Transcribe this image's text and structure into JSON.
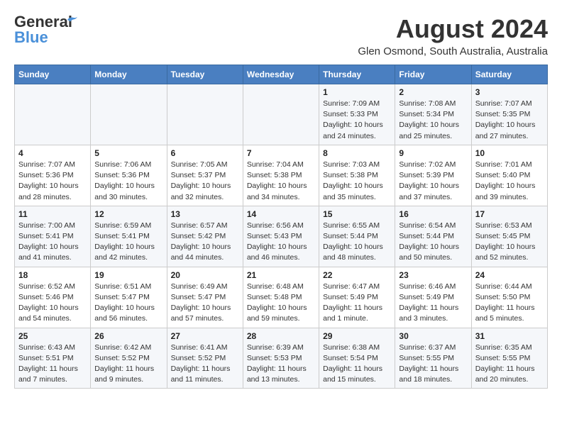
{
  "header": {
    "logo_line1": "General",
    "logo_line2": "Blue",
    "month_year": "August 2024",
    "location": "Glen Osmond, South Australia, Australia"
  },
  "weekdays": [
    "Sunday",
    "Monday",
    "Tuesday",
    "Wednesday",
    "Thursday",
    "Friday",
    "Saturday"
  ],
  "weeks": [
    [
      {
        "day": "",
        "info": ""
      },
      {
        "day": "",
        "info": ""
      },
      {
        "day": "",
        "info": ""
      },
      {
        "day": "",
        "info": ""
      },
      {
        "day": "1",
        "info": "Sunrise: 7:09 AM\nSunset: 5:33 PM\nDaylight: 10 hours\nand 24 minutes."
      },
      {
        "day": "2",
        "info": "Sunrise: 7:08 AM\nSunset: 5:34 PM\nDaylight: 10 hours\nand 25 minutes."
      },
      {
        "day": "3",
        "info": "Sunrise: 7:07 AM\nSunset: 5:35 PM\nDaylight: 10 hours\nand 27 minutes."
      }
    ],
    [
      {
        "day": "4",
        "info": "Sunrise: 7:07 AM\nSunset: 5:36 PM\nDaylight: 10 hours\nand 28 minutes."
      },
      {
        "day": "5",
        "info": "Sunrise: 7:06 AM\nSunset: 5:36 PM\nDaylight: 10 hours\nand 30 minutes."
      },
      {
        "day": "6",
        "info": "Sunrise: 7:05 AM\nSunset: 5:37 PM\nDaylight: 10 hours\nand 32 minutes."
      },
      {
        "day": "7",
        "info": "Sunrise: 7:04 AM\nSunset: 5:38 PM\nDaylight: 10 hours\nand 34 minutes."
      },
      {
        "day": "8",
        "info": "Sunrise: 7:03 AM\nSunset: 5:38 PM\nDaylight: 10 hours\nand 35 minutes."
      },
      {
        "day": "9",
        "info": "Sunrise: 7:02 AM\nSunset: 5:39 PM\nDaylight: 10 hours\nand 37 minutes."
      },
      {
        "day": "10",
        "info": "Sunrise: 7:01 AM\nSunset: 5:40 PM\nDaylight: 10 hours\nand 39 minutes."
      }
    ],
    [
      {
        "day": "11",
        "info": "Sunrise: 7:00 AM\nSunset: 5:41 PM\nDaylight: 10 hours\nand 41 minutes."
      },
      {
        "day": "12",
        "info": "Sunrise: 6:59 AM\nSunset: 5:41 PM\nDaylight: 10 hours\nand 42 minutes."
      },
      {
        "day": "13",
        "info": "Sunrise: 6:57 AM\nSunset: 5:42 PM\nDaylight: 10 hours\nand 44 minutes."
      },
      {
        "day": "14",
        "info": "Sunrise: 6:56 AM\nSunset: 5:43 PM\nDaylight: 10 hours\nand 46 minutes."
      },
      {
        "day": "15",
        "info": "Sunrise: 6:55 AM\nSunset: 5:44 PM\nDaylight: 10 hours\nand 48 minutes."
      },
      {
        "day": "16",
        "info": "Sunrise: 6:54 AM\nSunset: 5:44 PM\nDaylight: 10 hours\nand 50 minutes."
      },
      {
        "day": "17",
        "info": "Sunrise: 6:53 AM\nSunset: 5:45 PM\nDaylight: 10 hours\nand 52 minutes."
      }
    ],
    [
      {
        "day": "18",
        "info": "Sunrise: 6:52 AM\nSunset: 5:46 PM\nDaylight: 10 hours\nand 54 minutes."
      },
      {
        "day": "19",
        "info": "Sunrise: 6:51 AM\nSunset: 5:47 PM\nDaylight: 10 hours\nand 56 minutes."
      },
      {
        "day": "20",
        "info": "Sunrise: 6:49 AM\nSunset: 5:47 PM\nDaylight: 10 hours\nand 57 minutes."
      },
      {
        "day": "21",
        "info": "Sunrise: 6:48 AM\nSunset: 5:48 PM\nDaylight: 10 hours\nand 59 minutes."
      },
      {
        "day": "22",
        "info": "Sunrise: 6:47 AM\nSunset: 5:49 PM\nDaylight: 11 hours\nand 1 minute."
      },
      {
        "day": "23",
        "info": "Sunrise: 6:46 AM\nSunset: 5:49 PM\nDaylight: 11 hours\nand 3 minutes."
      },
      {
        "day": "24",
        "info": "Sunrise: 6:44 AM\nSunset: 5:50 PM\nDaylight: 11 hours\nand 5 minutes."
      }
    ],
    [
      {
        "day": "25",
        "info": "Sunrise: 6:43 AM\nSunset: 5:51 PM\nDaylight: 11 hours\nand 7 minutes."
      },
      {
        "day": "26",
        "info": "Sunrise: 6:42 AM\nSunset: 5:52 PM\nDaylight: 11 hours\nand 9 minutes."
      },
      {
        "day": "27",
        "info": "Sunrise: 6:41 AM\nSunset: 5:52 PM\nDaylight: 11 hours\nand 11 minutes."
      },
      {
        "day": "28",
        "info": "Sunrise: 6:39 AM\nSunset: 5:53 PM\nDaylight: 11 hours\nand 13 minutes."
      },
      {
        "day": "29",
        "info": "Sunrise: 6:38 AM\nSunset: 5:54 PM\nDaylight: 11 hours\nand 15 minutes."
      },
      {
        "day": "30",
        "info": "Sunrise: 6:37 AM\nSunset: 5:55 PM\nDaylight: 11 hours\nand 18 minutes."
      },
      {
        "day": "31",
        "info": "Sunrise: 6:35 AM\nSunset: 5:55 PM\nDaylight: 11 hours\nand 20 minutes."
      }
    ]
  ]
}
